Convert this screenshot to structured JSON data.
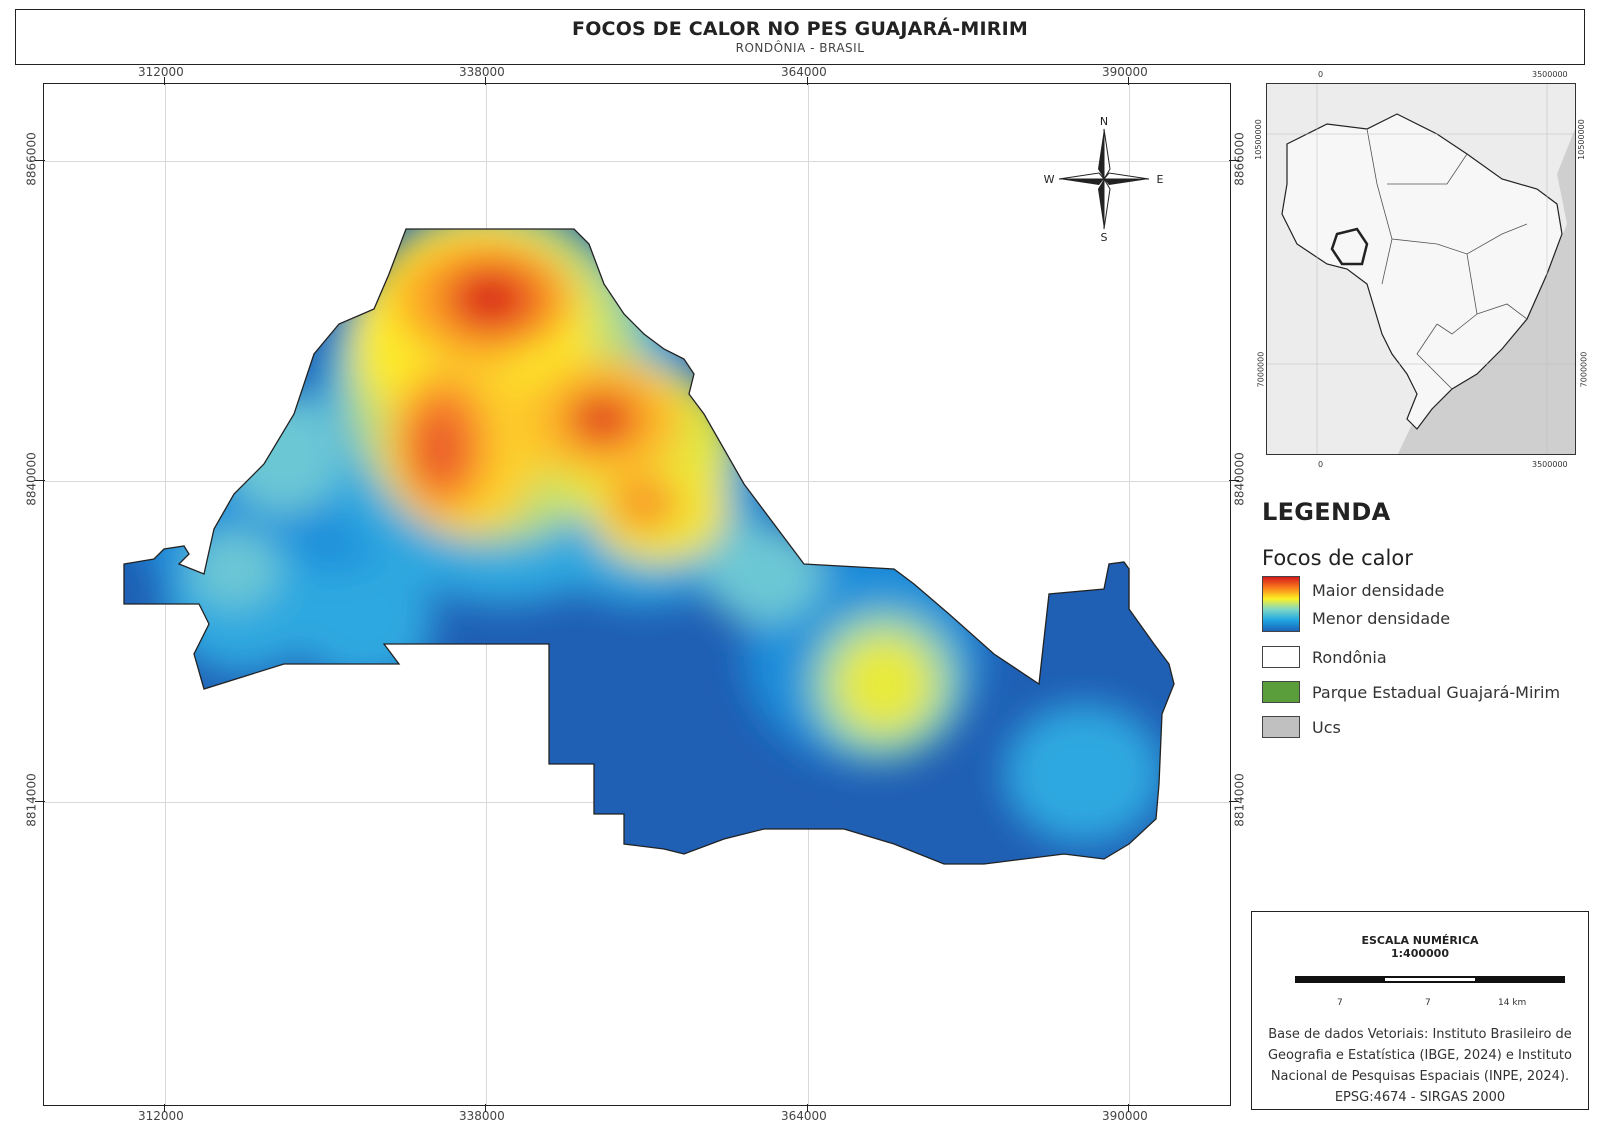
{
  "header": {
    "title": "FOCOS DE CALOR NO PES GUAJARÁ-MIRIM",
    "subtitle": "RONDÔNIA - BRASIL"
  },
  "map": {
    "x_ticks": [
      "312000",
      "338000",
      "364000",
      "390000"
    ],
    "y_ticks": [
      "8866000",
      "8840000",
      "8814000"
    ],
    "compass": {
      "n": "N",
      "s": "S",
      "e": "E",
      "w": "W"
    }
  },
  "inset": {
    "x_ticks": [
      "0",
      "3500000"
    ],
    "y_ticks": [
      "10500000",
      "7000000"
    ]
  },
  "legend": {
    "title": "LEGENDA",
    "subtitle": "Focos de calor",
    "gradient_high": "Maior densidade",
    "gradient_low": "Menor densidade",
    "items": [
      {
        "label": "Rondônia",
        "color": "#ffffff"
      },
      {
        "label": "Parque Estadual Guajará-Mirim",
        "color": "#5a9e3c"
      },
      {
        "label": "Ucs",
        "color": "#c0c0c0"
      }
    ]
  },
  "scale": {
    "title": "ESCALA NUMÉRICA",
    "ratio": "1:400000",
    "labels": [
      "7",
      "7",
      "14 km"
    ]
  },
  "credits": {
    "text": "Base de dados Vetoriais: Instituto Brasileiro de Geografia e Estatística (IBGE, 2024) e Instituto Nacional de Pesquisas Espaciais (INPE, 2024).",
    "crs": "EPSG:4674 - SIRGAS 2000"
  }
}
